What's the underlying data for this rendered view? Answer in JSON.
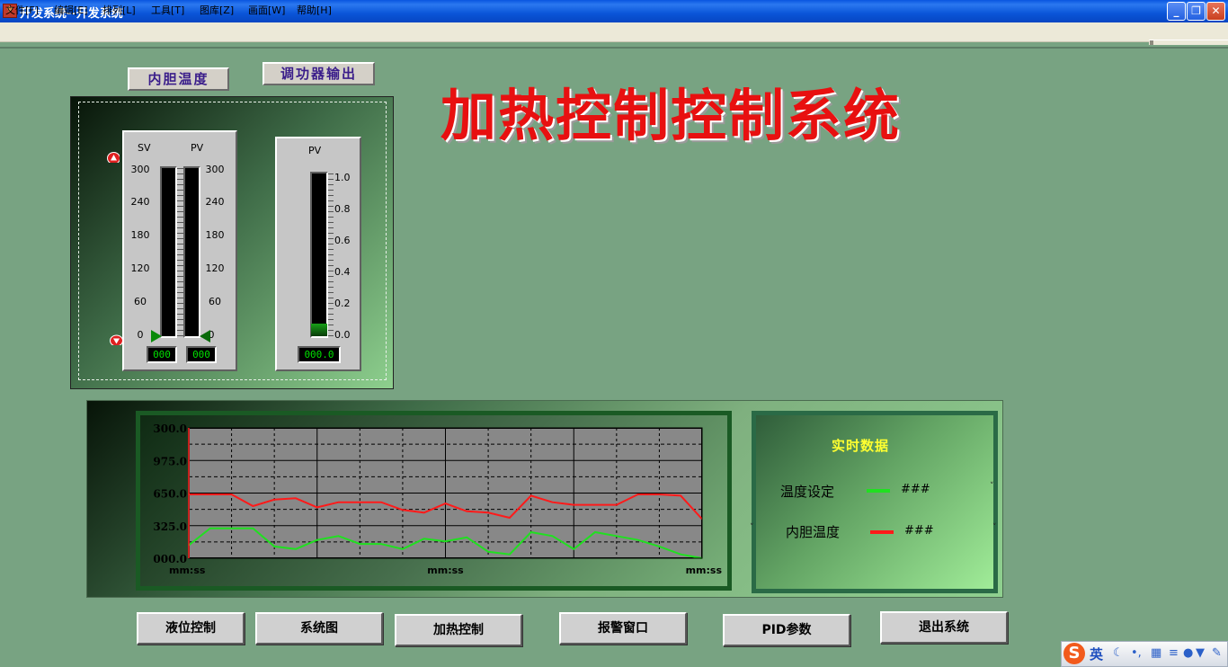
{
  "window": {
    "title": "开发系统--开发系统",
    "app_icon": "app-icon"
  },
  "menu": [
    {
      "label": "文件[F]"
    },
    {
      "label": "编辑[E]"
    },
    {
      "label": "排列[L]"
    },
    {
      "label": "工具[T]"
    },
    {
      "label": "图库[Z]"
    },
    {
      "label": "画面[W]"
    },
    {
      "label": "帮助[H]"
    }
  ],
  "tabs": {
    "inner_temp": "内胆温度",
    "power_output": "调功器输出"
  },
  "main_title": "加热控制控制系统",
  "gauge_left": {
    "sv_label": "SV",
    "pv_label": "PV",
    "ticks": [
      "300",
      "240",
      "180",
      "120",
      "60",
      "0"
    ],
    "sv_readout": "000",
    "pv_readout": "000"
  },
  "gauge_right": {
    "pv_label": "PV",
    "ticks": [
      "1.0",
      "0.8",
      "0.6",
      "0.4",
      "0.2",
      "0.0"
    ],
    "readout": "000.0",
    "level": 0.08
  },
  "chart_data": {
    "type": "line",
    "title": "",
    "y_tick_labels": [
      "300.0",
      "975.0",
      "650.0",
      "325.0",
      "000.0"
    ],
    "x_tick_labels": [
      "mm:ss",
      "mm:ss",
      "mm:ss"
    ],
    "grid": true,
    "series": [
      {
        "color": "#ff1a1a",
        "values": [
          0.49,
          0.49,
          0.49,
          0.4,
          0.45,
          0.46,
          0.39,
          0.43,
          0.43,
          0.43,
          0.37,
          0.35,
          0.42,
          0.36,
          0.35,
          0.31,
          0.48,
          0.43,
          0.41,
          0.41,
          0.41,
          0.49,
          0.49,
          0.48,
          0.3
        ]
      },
      {
        "color": "#20e020",
        "values": [
          0.1,
          0.23,
          0.23,
          0.23,
          0.09,
          0.07,
          0.14,
          0.17,
          0.11,
          0.11,
          0.07,
          0.15,
          0.13,
          0.16,
          0.05,
          0.03,
          0.2,
          0.17,
          0.07,
          0.2,
          0.17,
          0.14,
          0.09,
          0.03,
          0.0
        ]
      }
    ]
  },
  "realtime": {
    "title": "实时数据",
    "rows": [
      {
        "label": "温度设定",
        "value": "###",
        "color": "#20e020"
      },
      {
        "label": "内胆温度",
        "value": "###",
        "color": "#ff1a1a"
      }
    ]
  },
  "nav_buttons": [
    "液位控制",
    "系统图",
    "加热控制",
    "报警窗口",
    "PID参数",
    "退出系统"
  ],
  "ime": {
    "logo": "S",
    "lang": "英"
  }
}
